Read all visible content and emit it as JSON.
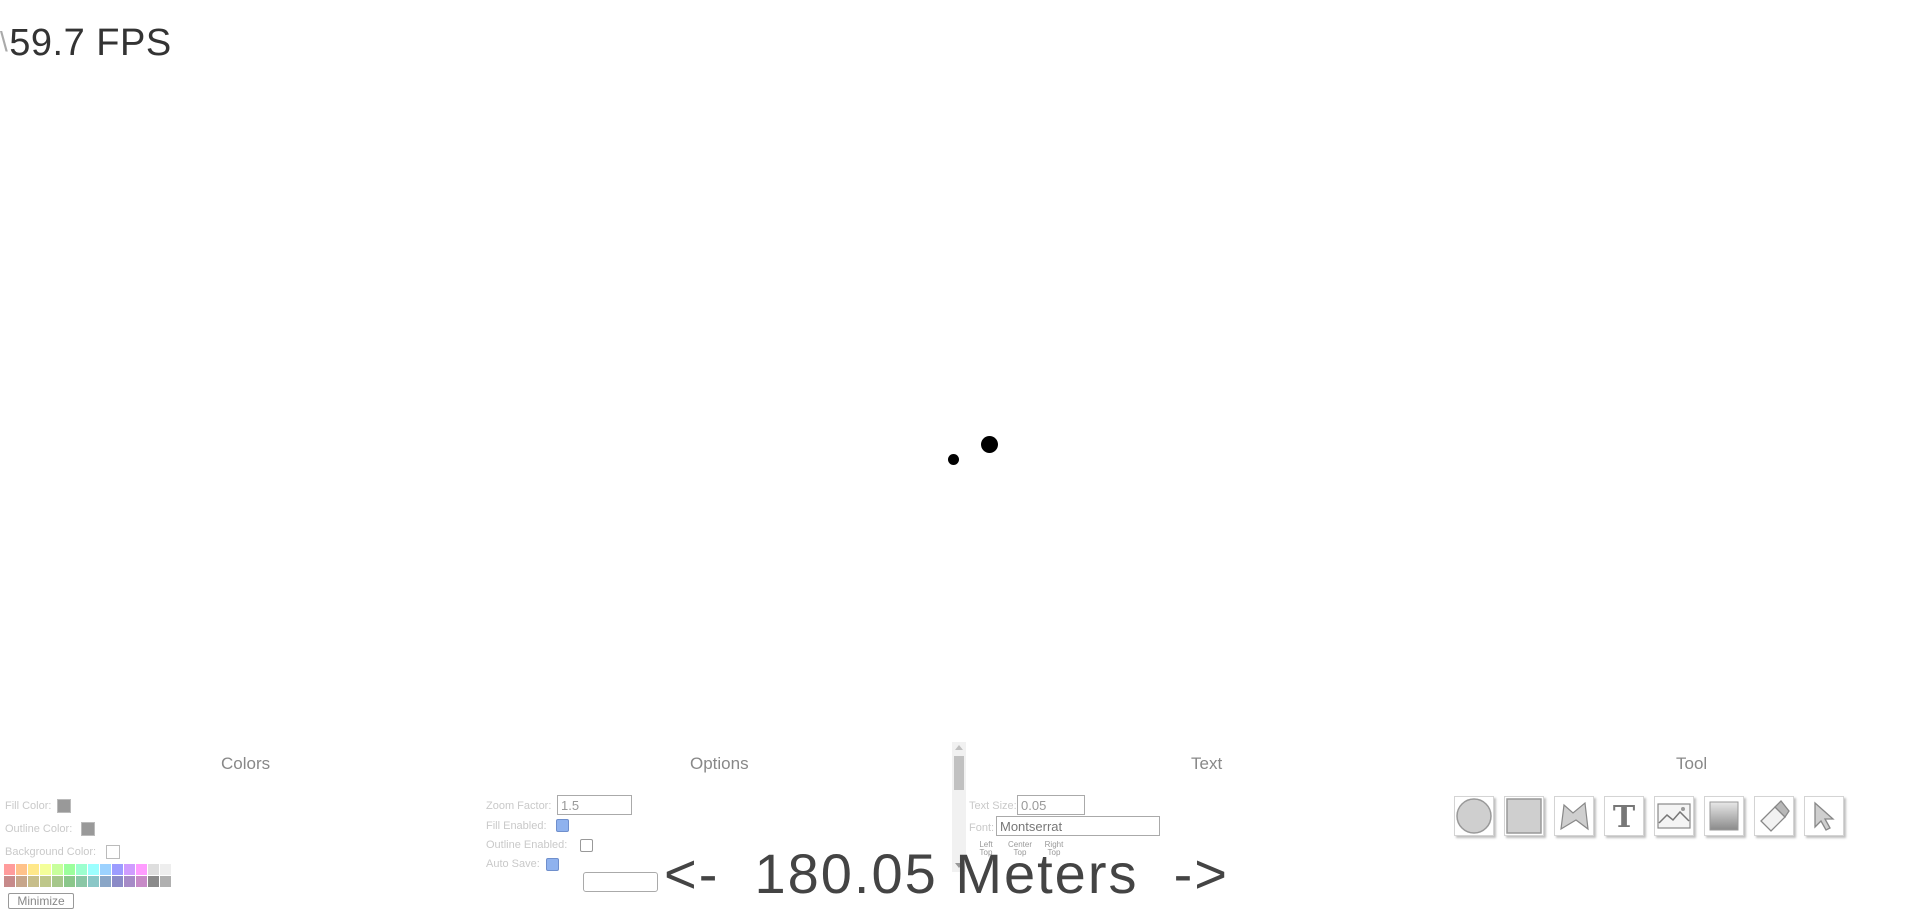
{
  "fps": {
    "caret": "\\",
    "value": "59.7 FPS"
  },
  "panels": {
    "colors": {
      "title": "Colors",
      "fill_color_label": "Fill Color:",
      "outline_color_label": "Outline Color:",
      "background_color_label": "Background Color:",
      "fill_color": "#999999",
      "outline_color": "#999999",
      "background_color": "#ffffff",
      "palette_row1": [
        "#ff9c9c",
        "#ffc28a",
        "#ffe88a",
        "#f4ff9a",
        "#c8ff9c",
        "#9cff9c",
        "#9cffcf",
        "#9cffff",
        "#9cd2ff",
        "#9c9cff",
        "#cf9cff",
        "#ff9cff",
        "#dedede",
        "#eeeeee"
      ],
      "palette_row2": [
        "#c78a8a",
        "#c7a68a",
        "#c7be8a",
        "#bec78a",
        "#a6c78a",
        "#8ac78a",
        "#8ac7a6",
        "#8ac7c7",
        "#8aa6c7",
        "#8a8ac7",
        "#a68ac7",
        "#c78ac7",
        "#8a8a8a",
        "#b0b0b0"
      ],
      "minimize_label": "Minimize"
    },
    "options": {
      "title": "Options",
      "zoom_factor_label": "Zoom Factor:",
      "zoom_factor_value": "1.5",
      "fill_enabled_label": "Fill Enabled:",
      "fill_enabled": true,
      "outline_enabled_label": "Outline Enabled:",
      "outline_enabled": false,
      "auto_save_label": "Auto Save:",
      "auto_save": true
    },
    "text": {
      "title": "Text",
      "text_size_label": "Text Size:",
      "text_size_value": "0.05",
      "font_label": "Font:",
      "font_value": "Montserrat",
      "alignments": [
        {
          "line1": "Left",
          "line2": "Top"
        },
        {
          "line1": "Center",
          "line2": "Top"
        },
        {
          "line1": "Right",
          "line2": "Top"
        }
      ]
    },
    "tool": {
      "title": "Tool",
      "tools": [
        "circle-tool",
        "rectangle-tool",
        "polygon-tool",
        "text-tool",
        "image-tool",
        "gradient-tool",
        "eraser-tool",
        "select-tool"
      ]
    }
  },
  "distance": {
    "prev": "<-",
    "value": "180.05 Meters",
    "next": "->"
  }
}
